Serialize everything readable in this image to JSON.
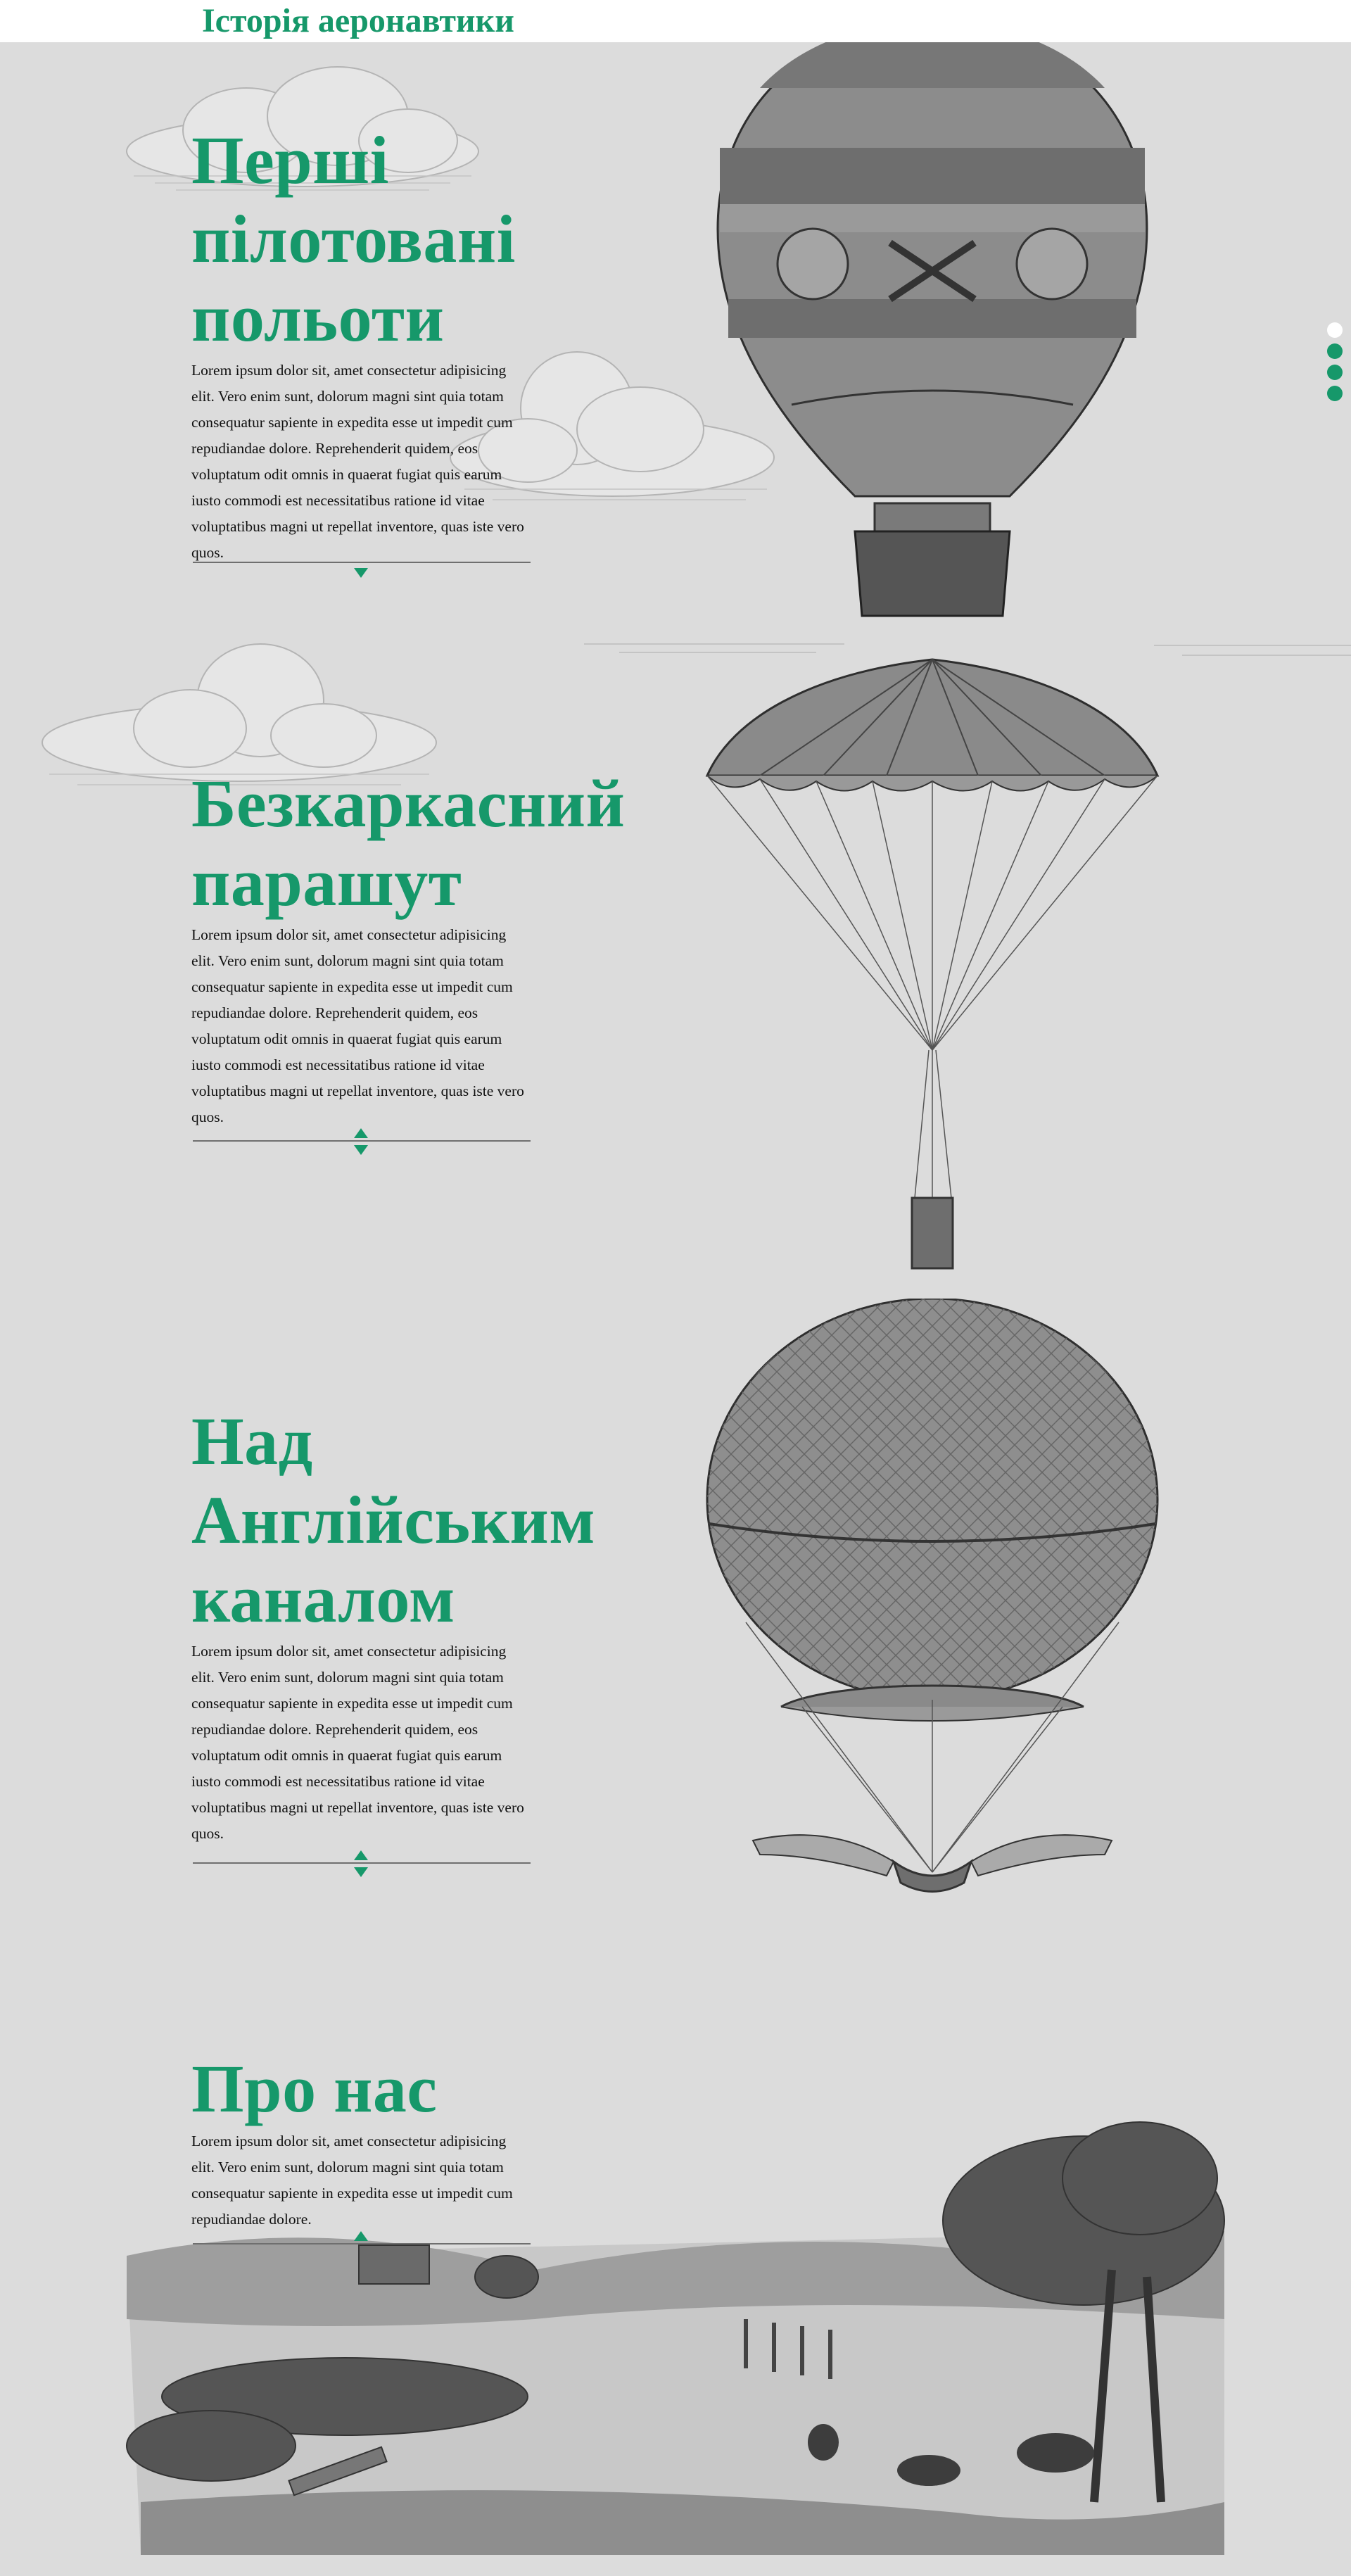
{
  "header": {
    "title": "Історія аеронавтики"
  },
  "sections": [
    {
      "title": "Перші пілотовані польоти",
      "body": "Lorem ipsum dolor sit, amet consectetur adipisicing elit. Vero enim sunt, dolorum magni sint quia totam consequatur sapiente in expedita esse ut impedit cum repudiandae dolore. Reprehenderit quidem, eos voluptatum odit omnis in quaerat fugiat quis earum iusto commodi est necessitatibus ratione id vitae voluptatibus magni ut repellat inventore, quas iste vero quos."
    },
    {
      "title": "Безкаркасний парашут",
      "body": "Lorem ipsum dolor sit, amet consectetur adipisicing elit. Vero enim sunt, dolorum magni sint quia totam consequatur sapiente in expedita esse ut impedit cum repudiandae dolore. Reprehenderit quidem, eos voluptatum odit omnis in quaerat fugiat quis earum iusto commodi est necessitatibus ratione id vitae voluptatibus magni ut repellat inventore, quas iste vero quos."
    },
    {
      "title": "Над Англійським каналом",
      "body": "Lorem ipsum dolor sit, amet consectetur adipisicing elit. Vero enim sunt, dolorum magni sint quia totam consequatur sapiente in expedita esse ut impedit cum repudiandae dolore. Reprehenderit quidem, eos voluptatum odit omnis in quaerat fugiat quis earum iusto commodi est necessitatibus ratione id vitae voluptatibus magni ut repellat inventore, quas iste vero quos."
    },
    {
      "title": "Про нас",
      "body": "Lorem ipsum dolor sit, amet consectetur adipisicing elit. Vero enim sunt, dolorum magni sint quia totam consequatur sapiente in expedita esse ut impedit cum repudiandae dolore."
    }
  ],
  "dot_nav": {
    "count": 4,
    "active_index": 0
  },
  "colors": {
    "accent": "#16986a",
    "background": "#dcdcdc",
    "header_bg": "#ffffff",
    "text": "#111111"
  },
  "icons": {
    "arrow_down": "triangle-down",
    "arrow_up": "triangle-up",
    "nav_dot": "circle"
  }
}
